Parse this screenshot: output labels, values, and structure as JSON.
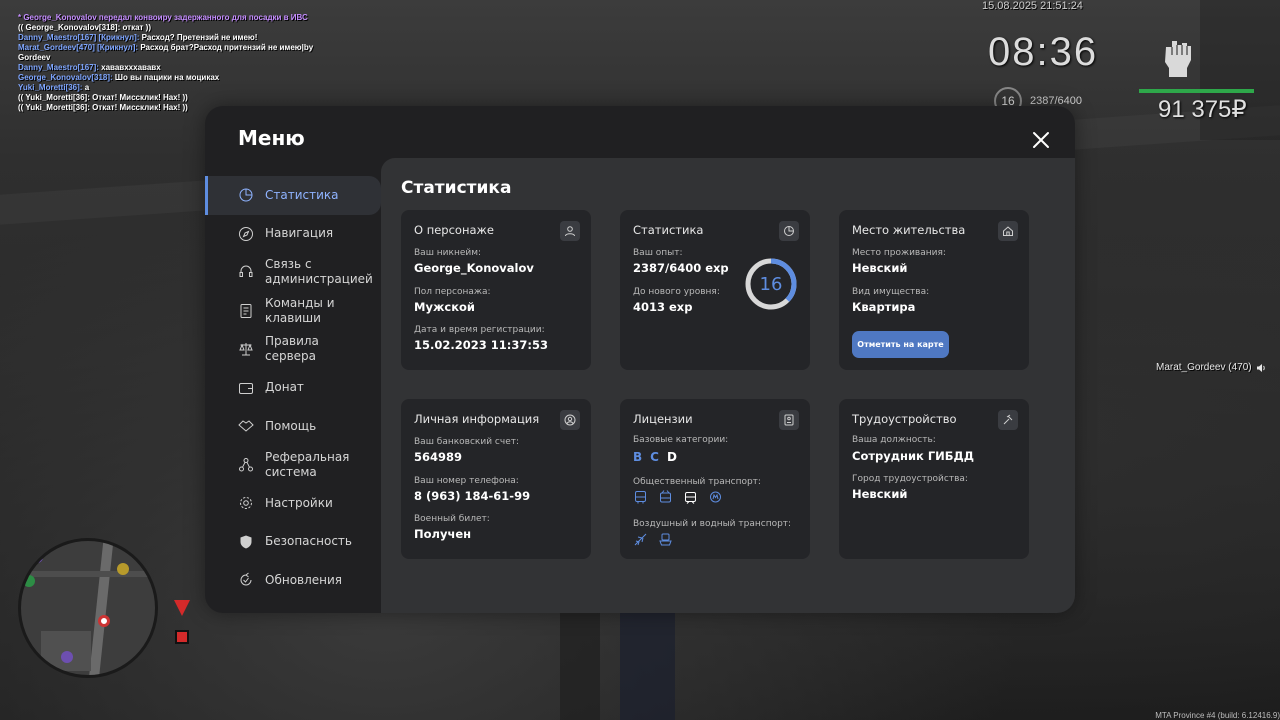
{
  "chat": [
    {
      "color": "purple",
      "text": "* George_Konovalov передал конвоиру задержанного для посадки в ИВС"
    },
    {
      "color": "white",
      "text": "(( George_Konovalov[318]: откат ))"
    },
    {
      "color": "blue",
      "name": "Danny_Maestro[167] [Крикнул]:",
      "text": " Расход? Претензий не имею!"
    },
    {
      "color": "blue",
      "name": "Marat_Gordeev[470] [Крикнул]:",
      "text": " Расход брат?Расход притензий не имею|by"
    },
    {
      "color": "white",
      "text": " Gordeev"
    },
    {
      "color": "blue",
      "name": "Danny_Maestro[167]:",
      "text": " хававхххававх"
    },
    {
      "color": "blue",
      "name": "George_Konovalov[318]:",
      "text": " Шо вы пацики на моциках"
    },
    {
      "color": "blue",
      "name": "Yuki_Moretti[36]:",
      "text": " а"
    },
    {
      "color": "white",
      "text": "(( Yuki_Moretti[36]: Откат! Миссклик! Нах! ))"
    },
    {
      "color": "white",
      "text": "(( Yuki_Moretti[36]: Откат! Миссклик! Нах! ))"
    }
  ],
  "hud": {
    "date": "15.08.2025 21:51:24",
    "time": "08:36",
    "level": "16",
    "exp": "2387/6400",
    "money": "91 375₽",
    "hp_fraction": 1.0
  },
  "nametag": "Marat_Gordeev (470)",
  "build": "MTA Province #4 (build: 6.12416.9)",
  "menu": {
    "title": "Меню",
    "sidebar": [
      {
        "label": "Статистика",
        "icon": "pie-chart-icon",
        "active": true
      },
      {
        "label": "Навигация",
        "icon": "compass-icon",
        "active": false
      },
      {
        "label": "Связь с администрацией",
        "icon": "headset-icon",
        "active": false
      },
      {
        "label": "Команды и клавиши",
        "icon": "document-icon",
        "active": false
      },
      {
        "label": "Правила сервера",
        "icon": "scales-icon",
        "active": false
      },
      {
        "label": "Донат",
        "icon": "wallet-icon",
        "active": false
      },
      {
        "label": "Помощь",
        "icon": "handshake-icon",
        "active": false
      },
      {
        "label": "Реферальная система",
        "icon": "network-icon",
        "active": false
      },
      {
        "label": "Настройки",
        "icon": "gear-icon",
        "active": false
      },
      {
        "label": "Безопасность",
        "icon": "shield-icon",
        "active": false
      },
      {
        "label": "Обновления",
        "icon": "refresh-icon",
        "active": false
      }
    ],
    "content_title": "Статистика",
    "cards": {
      "character": {
        "title": "О персонаже",
        "nick_label": "Ваш никнейм:",
        "nick": "George_Konovalov",
        "gender_label": "Пол персонажа:",
        "gender": "Мужской",
        "reg_label": "Дата и время регистрации:",
        "reg": "15.02.2023 11:37:53"
      },
      "stats": {
        "title": "Статистика",
        "exp_label": "Ваш опыт:",
        "exp": "2387/6400 exp",
        "next_label": "До нового уровня:",
        "next": "4013 exp",
        "level": "16",
        "progress": 0.373
      },
      "residence": {
        "title": "Место жительства",
        "place_label": "Место проживания:",
        "place": "Невский",
        "prop_label": "Вид имущества:",
        "prop": "Квартира",
        "button": "Отметить на карте"
      },
      "personal": {
        "title": "Личная информация",
        "bank_label": "Ваш банковский счет:",
        "bank": "564989",
        "phone_label": "Ваш номер телефона:",
        "phone": "8 (963) 184-61-99",
        "military_label": "Военный билет:",
        "military": "Получен"
      },
      "licenses": {
        "title": "Лицензии",
        "base_label": "Базовые категории:",
        "categories": [
          {
            "name": "B",
            "owned": true
          },
          {
            "name": "C",
            "owned": true
          },
          {
            "name": "D",
            "owned": false
          }
        ],
        "public_label": "Общественный транспорт:",
        "public": [
          "bus-icon",
          "trolleybus-icon",
          "tram-icon",
          "metro-icon"
        ],
        "public_owned": [
          true,
          true,
          false,
          true
        ],
        "air_label": "Воздушный и водный транспорт:",
        "air": [
          "plane-icon",
          "boat-icon"
        ]
      },
      "job": {
        "title": "Трудоустройство",
        "pos_label": "Ваша должность:",
        "pos": "Сотрудник ГИБДД",
        "city_label": "Город трудоустройства:",
        "city": "Невский"
      }
    }
  },
  "colors": {
    "accent": "#5e8de0",
    "button": "#4f78c2",
    "card": "#242528",
    "panel": "#323335"
  }
}
